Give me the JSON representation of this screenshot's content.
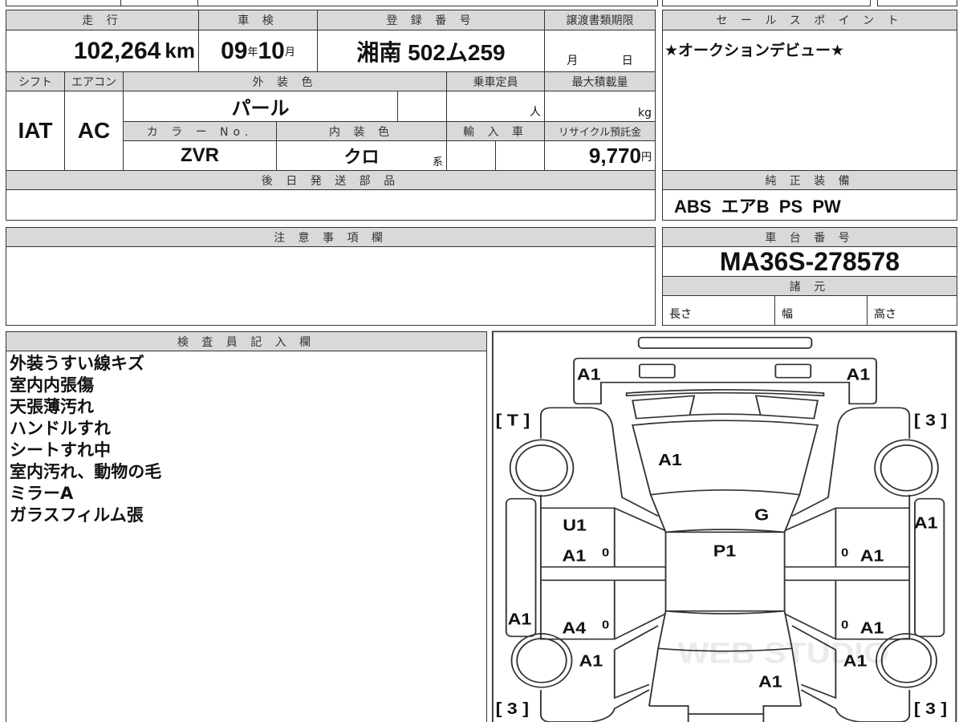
{
  "header": {
    "mileage": "走 行",
    "inspection": "車 検",
    "registration": "登 録 番 号",
    "transfer_deadline": "譲渡書類期限",
    "shift": "シフト",
    "aircon": "エアコン",
    "exterior_color": "外 装 色",
    "capacity": "乗車定員",
    "max_load": "最大積載量",
    "color_no": "カ ラ ー No.",
    "interior_color": "内 装 色",
    "import": "輸 入 車",
    "recycle": "リサイクル預託金",
    "later_parts": "後 日 発 送 部 品",
    "sales_point": "セ ー ル ス ポ イ ン ト",
    "genuine_equipment": "純 正 装 備",
    "notes": "注 意 事 項 欄",
    "chassis_no": "車 台 番 号",
    "specs": "諸 元",
    "inspector": "検 査 員 記 入 欄"
  },
  "values": {
    "mileage": "102,264",
    "mileage_unit": "km",
    "inspection_year": "09",
    "year_unit": "年",
    "inspection_month": "10",
    "month_unit": "月",
    "registration": "湘南 502ム259",
    "deadline_month": "月",
    "deadline_day": "日",
    "shift": "IAT",
    "aircon": "AC",
    "exterior_color": "パール",
    "capacity_unit": "人",
    "load_unit": "kg",
    "color_no": "ZVR",
    "interior_color": "クロ",
    "interior_suffix": "系",
    "recycle": "9,770",
    "recycle_unit": "円",
    "sales_point": "★オークションデビュー★",
    "equipment": "ABS  エアB  PS  PW",
    "chassis_no": "MA36S-278578",
    "length": "長さ",
    "width": "幅",
    "height": "高さ"
  },
  "inspector_notes": [
    "外装うすい線キズ",
    "室内内張傷",
    "天張薄汚れ",
    "ハンドルすれ",
    "シートすれ中",
    "室内汚れ、動物の毛",
    "ミラーA",
    "ガラスフィルム張"
  ],
  "diagram": {
    "front_bumper_left": "A1",
    "front_bumper_right": "A1",
    "tire_fl": "[ T ]",
    "tire_fr": "[ 3 ]",
    "hood": "A1",
    "windshield": "G",
    "fender_l": "U1",
    "door_fl": "A1",
    "roof": "P1",
    "door_fr": "A1",
    "skirt_r": "A1",
    "skirt_l": "A1",
    "door_rl": "A4",
    "door_rr": "A1",
    "quarter_l": "A1",
    "quarter_r": "A1",
    "trunk": "A1",
    "tire_rl": "[ 3 ]",
    "tire_rr": "[ 3 ]",
    "zero": "0",
    "watermark": "WEB STUDIO"
  }
}
